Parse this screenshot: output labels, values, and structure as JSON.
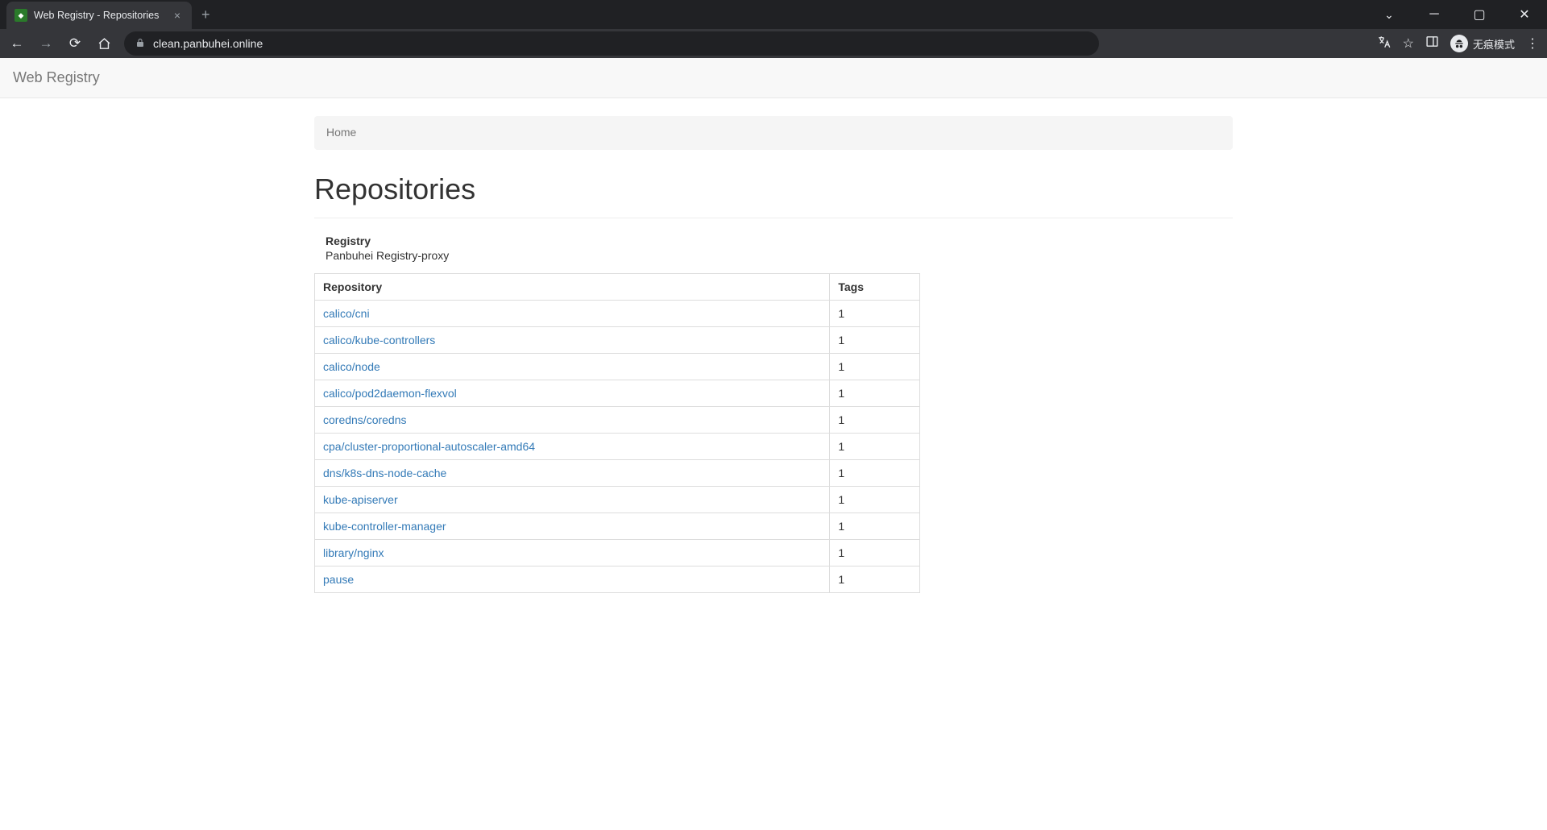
{
  "browser": {
    "tab_title": "Web Registry - Repositories",
    "url": "clean.panbuhei.online",
    "incognito_label": "无痕模式"
  },
  "header": {
    "brand": "Web Registry"
  },
  "breadcrumb": {
    "home": "Home"
  },
  "page": {
    "title": "Repositories",
    "registry_label": "Registry",
    "registry_value": "Panbuhei Registry-proxy"
  },
  "table": {
    "columns": {
      "repo": "Repository",
      "tags": "Tags"
    },
    "rows": [
      {
        "name": "calico/cni",
        "tags": "1"
      },
      {
        "name": "calico/kube-controllers",
        "tags": "1"
      },
      {
        "name": "calico/node",
        "tags": "1"
      },
      {
        "name": "calico/pod2daemon-flexvol",
        "tags": "1"
      },
      {
        "name": "coredns/coredns",
        "tags": "1"
      },
      {
        "name": "cpa/cluster-proportional-autoscaler-amd64",
        "tags": "1"
      },
      {
        "name": "dns/k8s-dns-node-cache",
        "tags": "1"
      },
      {
        "name": "kube-apiserver",
        "tags": "1"
      },
      {
        "name": "kube-controller-manager",
        "tags": "1"
      },
      {
        "name": "library/nginx",
        "tags": "1"
      },
      {
        "name": "pause",
        "tags": "1"
      }
    ]
  }
}
